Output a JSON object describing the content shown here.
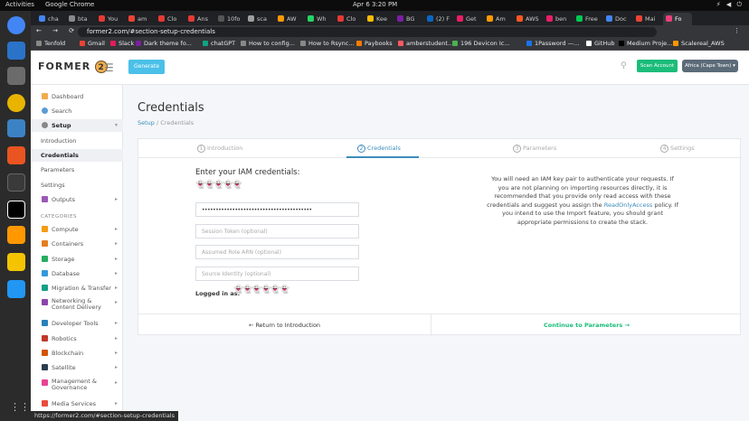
{
  "os": {
    "activities": "Activities",
    "app_name": "Google Chrome",
    "clock": "Apr 6  3:20 PM",
    "sys_icons": "⚡ ◀ ⏻"
  },
  "browser": {
    "tabs": [
      "cha",
      "bta",
      "You",
      "am",
      "Clo",
      "Ans",
      "10fo",
      "sca",
      "AW",
      "Wh",
      "Clo",
      "Kee",
      "BG",
      "(2) F",
      "Get",
      "Am",
      "AWS",
      "ben",
      "Free",
      "Doc",
      "Mai",
      "Fo"
    ],
    "active_tab": "Fo",
    "url": "former2.com/#section-setup-credentials",
    "nav": "← → ⟳",
    "extras": "⋮",
    "bookmarks": [
      "Tenfold",
      "Gmail",
      "Slack",
      "Dark theme fo...",
      "chatGPT",
      "How to config...",
      "How to Rsync...",
      "Paybooks",
      "amberstudent....",
      "196 Devicon Ic...",
      "1Password —...",
      "GitHub",
      "Medium Proje...",
      "Scalereal_AWS"
    ]
  },
  "header": {
    "logo_text": "FORMER",
    "logo_num": "2",
    "menu_icon": "☰",
    "generate": "Generate",
    "search_icon": "⚲",
    "scan": "Scan Account",
    "region": "Africa (Cape Town) ▾"
  },
  "sidebar": {
    "dashboard": "Dashboard",
    "search": "Search",
    "setup": "Setup",
    "introduction": "Introduction",
    "credentials": "Credentials",
    "parameters": "Parameters",
    "settings": "Settings",
    "outputs": "Outputs",
    "categories_heading": "CATEGORIES",
    "compute": "Compute",
    "containers": "Containers",
    "storage": "Storage",
    "database": "Database",
    "migration": "Migration & Transfer",
    "networking_1": "Networking &",
    "networking_2": "Content Delivery",
    "devtools": "Developer Tools",
    "robotics": "Robotics",
    "blockchain": "Blockchain",
    "satellite": "Satellite",
    "mgmt_1": "Management &",
    "mgmt_2": "Governance",
    "media": "Media Services"
  },
  "main": {
    "title": "Credentials",
    "crumb_setup": "Setup",
    "crumb_sep": "/",
    "crumb_current": "Credentials"
  },
  "steps": [
    {
      "num": "1",
      "label": "Introduction"
    },
    {
      "num": "2",
      "label": "Credentials"
    },
    {
      "num": "3",
      "label": "Parameters"
    },
    {
      "num": "4",
      "label": "Settings"
    }
  ],
  "form": {
    "heading": "Enter your IAM credentials:",
    "access_key_mask": "👻👻👻👻👻",
    "secret_key_value": "••••••••••••••••••••••••••••••••••••••••",
    "session_token_ph": "Session Token (optional)",
    "role_arn_ph": "Assumed Role ARN (optional)",
    "source_identity_ph": "Source Identity (optional)",
    "logged_in": "Logged in as:",
    "logged_in_mask": "👻👻👻👻👻👻"
  },
  "info": {
    "text_1": "You will need an IAM key pair to authenticate your requests. If you are not planning on importing resources directly, it is recommended that you provide only read access with these credentials and suggest you assign the",
    "link": "ReadOnlyAccess",
    "text_2": "policy. If you intend to use the Import feature, you should grant appropriate permissions to create the stack."
  },
  "footer": {
    "back": "← Return to Introduction",
    "continue": "Continue to Parameters →"
  },
  "status_url": "https://former2.com/#section-setup-credentials"
}
